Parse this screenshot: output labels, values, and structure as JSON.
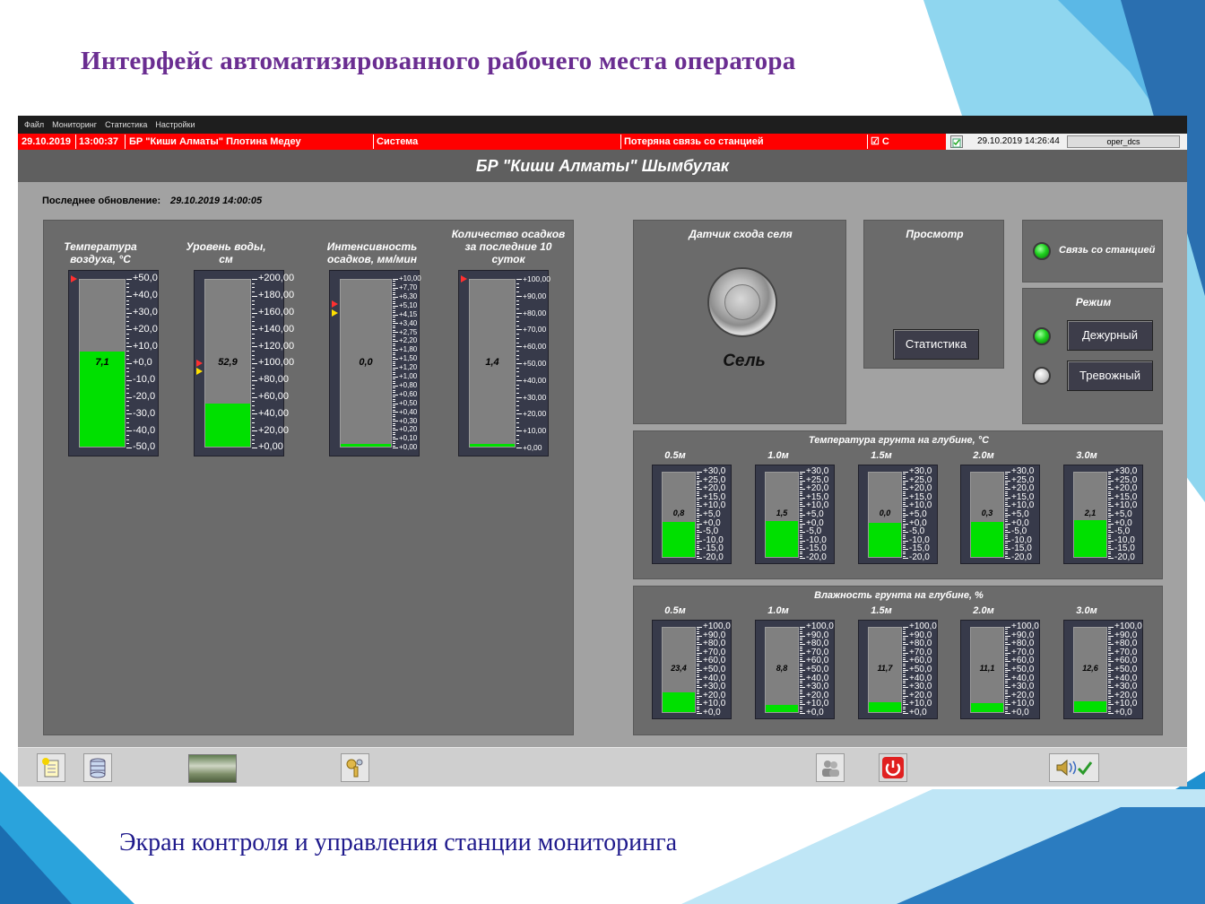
{
  "slide": {
    "title": "Интерфейс автоматизированного рабочего места оператора",
    "caption": "Экран контроля и управления станции мониторинга"
  },
  "menu": [
    "Файл",
    "Мониторинг",
    "Статистика",
    "Настройки"
  ],
  "alarm": {
    "date": "29.10.2019",
    "time": "13:00:37",
    "source": "БР \"Киши Алматы\" Плотина Медеу",
    "category": "Система",
    "message": "Потеряна связь со станцией",
    "ack": "☑ С",
    "current_datetime": "29.10.2019 14:26:44",
    "user": "oper_dcs"
  },
  "station_title": "БР \"Киши Алматы\" Шымбулак",
  "last_update": {
    "label": "Последнее обновление:",
    "value": "29.10.2019 14:00:05"
  },
  "main_gauges": [
    {
      "title": "Температура воздуха, °С",
      "value": "7,1",
      "fraction": 0.57,
      "labels": [
        "+50,0",
        "+40,0",
        "+30,0",
        "+20,0",
        "+10,0",
        "+0,0",
        "-10,0",
        "-20,0",
        "-30,0",
        "-40,0",
        "-50,0"
      ]
    },
    {
      "title": "Уровень воды, см",
      "value": "52,9",
      "fraction": 0.26,
      "labels": [
        "+200,00",
        "+180,00",
        "+160,00",
        "+140,00",
        "+120,00",
        "+100,00",
        "+80,00",
        "+60,00",
        "+40,00",
        "+20,00",
        "+0,00"
      ]
    },
    {
      "title": "Интенсивность осадков, мм/мин",
      "value": "0,0",
      "fraction": 0.0,
      "labels": [
        "+10,00",
        "+7,70",
        "+6,30",
        "+5,10",
        "+4,15",
        "+3,40",
        "+2,75",
        "+2,20",
        "+1,80",
        "+1,50",
        "+1,20",
        "+1,00",
        "+0,80",
        "+0,60",
        "+0,50",
        "+0,40",
        "+0,30",
        "+0,20",
        "+0,10",
        "+0,00"
      ]
    },
    {
      "title": "Количество осадков за последние 10 суток",
      "value": "1,4",
      "fraction": 0.014,
      "labels": [
        "+100,00",
        "+90,00",
        "+80,00",
        "+70,00",
        "+60,00",
        "+50,00",
        "+40,00",
        "+30,00",
        "+20,00",
        "+10,00",
        "+0,00"
      ]
    }
  ],
  "sel_sensor": {
    "title": "Датчик схода селя",
    "label": "Сель"
  },
  "view": {
    "title": "Просмотр",
    "button": "Статистика"
  },
  "connection": {
    "label": "Связь со станцией",
    "state": "on"
  },
  "mode": {
    "title": "Режим",
    "duty": "Дежурный",
    "alarm": "Тревожный",
    "duty_state": "on",
    "alarm_state": "off"
  },
  "soil_temp": {
    "title": "Температура грунта на глубине, °С",
    "labels": [
      "+30,0",
      "+25,0",
      "+20,0",
      "+15,0",
      "+10,0",
      "+5,0",
      "+0,0",
      "-5,0",
      "-10,0",
      "-15,0",
      "-20,0"
    ],
    "items": [
      {
        "depth": "0.5м",
        "value": "0,8",
        "fraction": 0.42
      },
      {
        "depth": "1.0м",
        "value": "1,5",
        "fraction": 0.43
      },
      {
        "depth": "1.5м",
        "value": "0,0",
        "fraction": 0.4
      },
      {
        "depth": "2.0м",
        "value": "0,3",
        "fraction": 0.41
      },
      {
        "depth": "3.0м",
        "value": "2,1",
        "fraction": 0.44
      }
    ]
  },
  "soil_moist": {
    "title": "Влажность грунта на глубине, %",
    "labels": [
      "+100,0",
      "+90,0",
      "+80,0",
      "+70,0",
      "+60,0",
      "+50,0",
      "+40,0",
      "+30,0",
      "+20,0",
      "+10,0",
      "+0,0"
    ],
    "items": [
      {
        "depth": "0.5м",
        "value": "23,4",
        "fraction": 0.234
      },
      {
        "depth": "1.0м",
        "value": "8,8",
        "fraction": 0.088
      },
      {
        "depth": "1.5м",
        "value": "11,7",
        "fraction": 0.117
      },
      {
        "depth": "2.0м",
        "value": "11,1",
        "fraction": 0.111
      },
      {
        "depth": "3.0м",
        "value": "12,6",
        "fraction": 0.126
      }
    ]
  },
  "toolbar": [
    "new-report-icon",
    "database-icon",
    "photo-thumbnail",
    "keys-icon",
    "users-icon",
    "power-icon",
    "sound-check-icon"
  ],
  "colors": {
    "alarm": "#ff0000",
    "fill": "#00e000",
    "panel": "#6b6b6b",
    "title": "#6a2d91",
    "caption": "#1f1a8c"
  }
}
